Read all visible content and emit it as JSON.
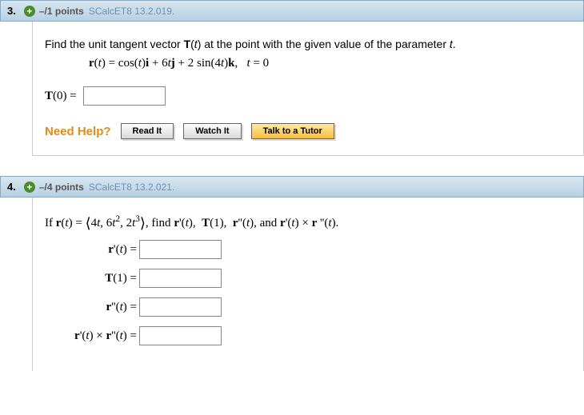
{
  "q3": {
    "number": "3.",
    "points": "–/1 points",
    "source": "SCalcET8 13.2.019.",
    "prompt_pre": "Find the unit tangent vector ",
    "prompt_T": "T",
    "prompt_mid": "(",
    "prompt_t": "t",
    "prompt_post": ") at the point with the given value of the parameter ",
    "prompt_t2": "t",
    "prompt_end": ".",
    "eq_lhs": "r",
    "eq_open": "(",
    "eq_var": "t",
    "eq_close": ") = cos(",
    "eq_var2": "t",
    "eq_part2": ")",
    "eq_i": "i",
    "eq_plus1": " + 6",
    "eq_var3": "t",
    "eq_j": "j",
    "eq_plus2": " + 2 sin(4",
    "eq_var4": "t",
    "eq_close2": ")",
    "eq_k": "k",
    "eq_comma": ",",
    "eq_tcond": "t",
    "eq_cond": " = 0",
    "answer_label": "T(0) =",
    "answer_label_T": "T",
    "answer_label_rest": "(0) =",
    "need_help": "Need Help?",
    "btn_read": "Read It",
    "btn_watch": "Watch It",
    "btn_tutor": "Talk to a Tutor"
  },
  "q4": {
    "number": "4.",
    "points": "–/4 points",
    "source": "SCalcET8 13.2.021.",
    "prompt_if": "If  ",
    "r": "r",
    "t": "t",
    "prompt_find": ",  find  ",
    "prompt_and": ",  and  ",
    "labels": {
      "l1_r": "r",
      "l1_rest": "'(",
      "l1_t": "t",
      "l1_end": ") =",
      "l2_T": "T",
      "l2_rest": "(1) =",
      "l3_r": "r",
      "l3_rest": "''(",
      "l3_t": "t",
      "l3_end": ") =",
      "l4_r1": "r",
      "l4_m1": "'(",
      "l4_t1": "t",
      "l4_m2": ") × ",
      "l4_r2": "r",
      "l4_m3": "''(",
      "l4_t2": "t",
      "l4_end": ") ="
    }
  }
}
